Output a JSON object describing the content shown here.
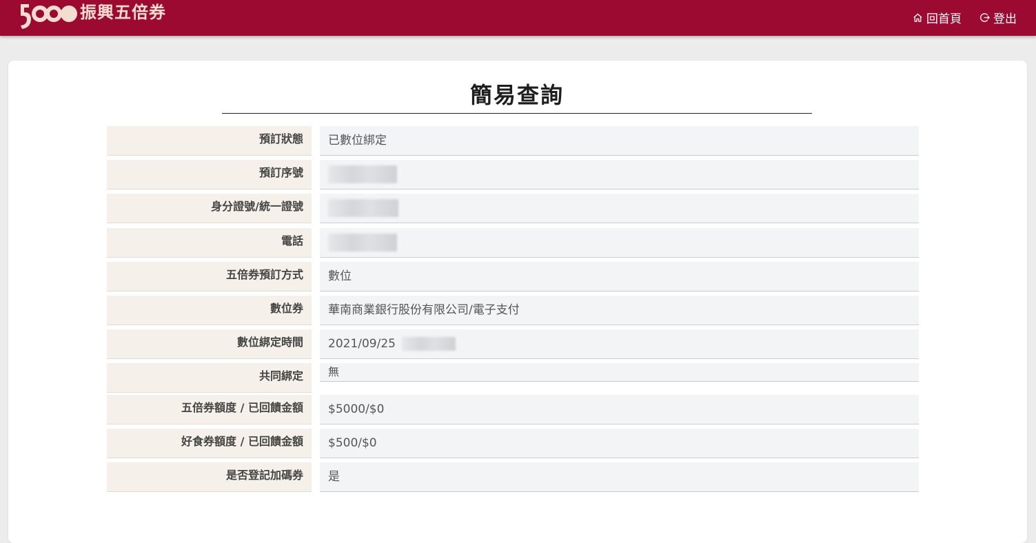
{
  "header": {
    "logo_text": "振興五倍券",
    "logo_mark_text": "5000",
    "home_label": "回首頁",
    "logout_label": "登出",
    "brand_color": "#9c0a31"
  },
  "page": {
    "title": "簡易查詢"
  },
  "rows": [
    {
      "label": "預訂狀態",
      "value": "已數位綁定"
    },
    {
      "label": "預訂序號",
      "value": ""
    },
    {
      "label": "身分證號/統一證號",
      "value": ""
    },
    {
      "label": "電話",
      "value": ""
    },
    {
      "label": "五倍券預訂方式",
      "value": "數位"
    },
    {
      "label": "數位券",
      "value": "華南商業銀行股份有限公司/電子支付"
    },
    {
      "label": "數位綁定時間",
      "value": "2021/09/25"
    },
    {
      "label": "共同綁定",
      "value": "無"
    },
    {
      "label": "五倍券額度 / 已回饋金額",
      "value": "$5000/$0"
    },
    {
      "label": "好食券額度 / 已回饋金額",
      "value": "$500/$0"
    },
    {
      "label": "是否登記加碼券",
      "value": "是"
    }
  ]
}
